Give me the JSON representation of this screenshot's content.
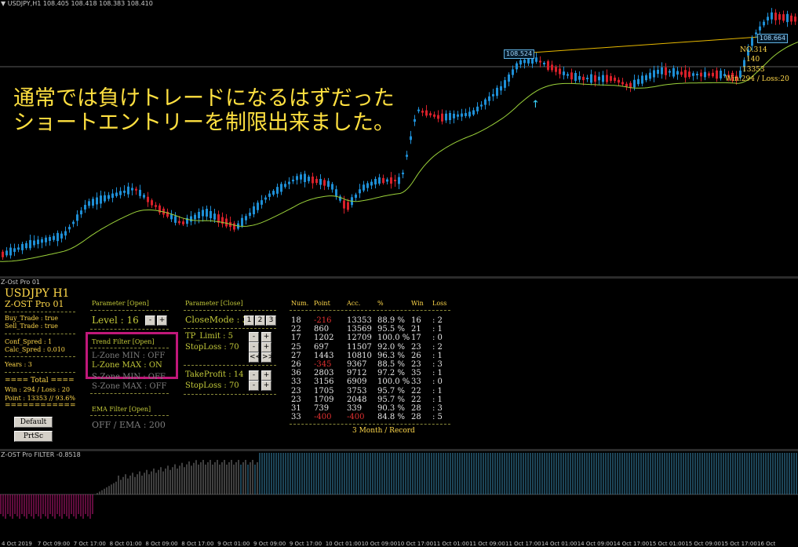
{
  "main_chart": {
    "caption": "▼ USDJPY,H1  108.405 108.418 108.383 108.410",
    "overlay_line1": "通常では負けトレードになるはずだった",
    "overlay_line2": "ショートエントリーを制限出来ました。",
    "price_tag_left": "108.524",
    "price_tag_right": "108.664",
    "annotations": [
      "NO.314",
      "140",
      "13353",
      "Win:294 / Loss:20"
    ]
  },
  "panel": {
    "caption": "Z-Ost Pro 01",
    "symbol": "USDJPY H1",
    "product": "Z-OST Pro 01",
    "buy_trade": "Buy_Trade : true",
    "sell_trade": "Sell_Trade : true",
    "conf_spred": "Conf_Spred : 1",
    "calc_spred": "Calc_Spred : 0.010",
    "years": "Years : 3",
    "total_header": "==== Total ====",
    "win_loss": "Win : 294  /  Loss : 20",
    "point": "Point : 13353 // 93.6%",
    "equals": "============",
    "default_btn": "Default",
    "prtsc_btn": "PrtSc",
    "param_open": "Parameter [Open]",
    "level": "Level : 16",
    "trend_filter": "Trend Filter [Open]",
    "l_zone_min": "L-Zone MIN  : OFF",
    "l_zone_max": "L-Zone MAX : ON",
    "s_zone_min": "S-Zone MIN  : OFF",
    "s_zone_max": "S-Zone MAX : OFF",
    "ema_filter": "EMA Filter [Open]",
    "ema_values": "OFF  /   EMA : 200",
    "param_close": "Parameter [Close]",
    "close_mode": "CloseMode : 3",
    "mode_buttons": [
      "1",
      "2",
      "3"
    ],
    "tp_limit": "TP_Limit : 5",
    "stop_loss_1": "StopLoss : 70",
    "take_profit": "TakeProfit : 14",
    "stop_loss_2": "StopLoss : 70",
    "minus": "-",
    "plus": "+",
    "prev": "<<",
    "next": ">>",
    "table": {
      "headers": [
        "Num.",
        "Point",
        "Acc.",
        "%",
        "Win",
        "Loss"
      ],
      "rows": [
        [
          "18",
          "-216",
          "13353",
          "88.9  %",
          "16",
          ": 2"
        ],
        [
          "22",
          "860",
          "13569",
          "95.5  %",
          "21",
          ": 1"
        ],
        [
          "17",
          "1202",
          "12709",
          "100.0  %",
          "17",
          ": 0"
        ],
        [
          "25",
          "697",
          "11507",
          "92.0  %",
          "23",
          ": 2"
        ],
        [
          "27",
          "1443",
          "10810",
          "96.3  %",
          "26",
          ": 1"
        ],
        [
          "26",
          "-345",
          "9367",
          "88.5  %",
          "23",
          ": 3"
        ],
        [
          "36",
          "2803",
          "9712",
          "97.2  %",
          "35",
          ": 1"
        ],
        [
          "33",
          "3156",
          "6909",
          "100.0  %",
          "33",
          ": 0"
        ],
        [
          "23",
          "1705",
          "3753",
          "95.7  %",
          "22",
          ": 1"
        ],
        [
          "23",
          "1709",
          "2048",
          "95.7  %",
          "22",
          ": 1"
        ],
        [
          "31",
          "739",
          "339",
          "90.3  %",
          "28",
          ": 3"
        ],
        [
          "33",
          "-400",
          "-400",
          "84.8  %",
          "28",
          ": 5"
        ]
      ],
      "footer": "3 Month / Record"
    }
  },
  "filter_chart": {
    "caption": "Z-OST Pro FILTER -0.8518"
  },
  "time_axis": [
    "4 Oct 2019",
    "7 Oct 09:00",
    "7 Oct 17:00",
    "8 Oct 01:00",
    "8 Oct 09:00",
    "8 Oct 17:00",
    "9 Oct 01:00",
    "9 Oct 09:00",
    "9 Oct 17:00",
    "10 Oct 01:00",
    "10 Oct 09:00",
    "10 Oct 17:00",
    "11 Oct 01:00",
    "11 Oct 09:00",
    "11 Oct 17:00",
    "14 Oct 01:00",
    "14 Oct 09:00",
    "14 Oct 17:00",
    "15 Oct 01:00",
    "15 Oct 09:00",
    "15 Oct 17:00",
    "16 Oct"
  ],
  "colors": {
    "bull": "#1e8fd6",
    "bear": "#d8202a",
    "ema": "#9bd23a",
    "level": "#e6b800",
    "filter_pos": "#3a8ab0",
    "filter_neg": "#c0187a",
    "filter_grey": "#808080"
  }
}
